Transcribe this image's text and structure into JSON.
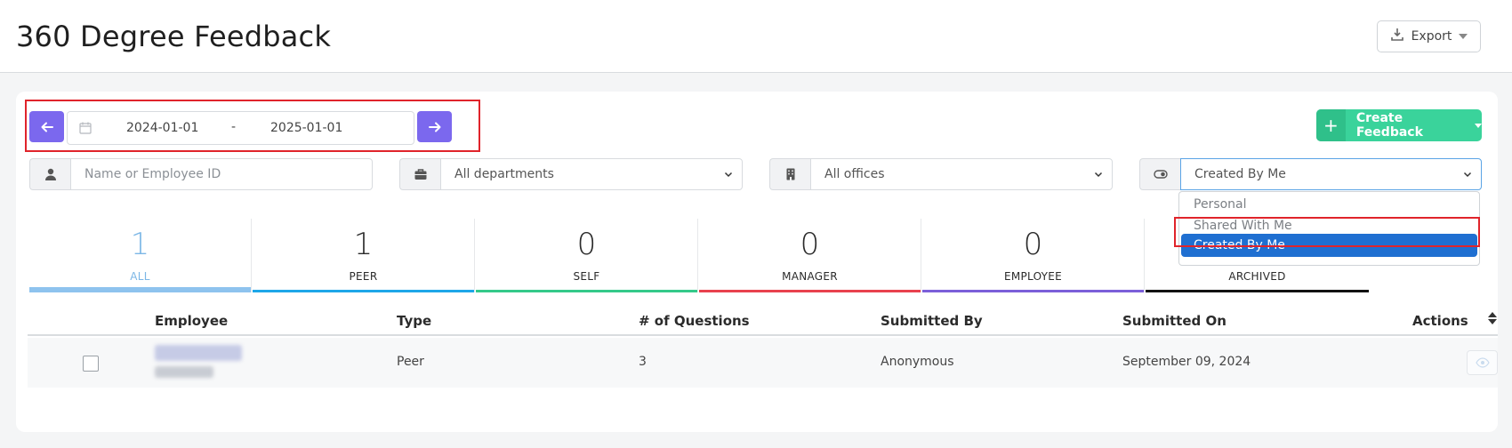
{
  "header": {
    "title": "360 Degree Feedback",
    "export_label": "Export"
  },
  "date_range": {
    "start": "2024-01-01",
    "separator": "-",
    "end": "2025-01-01"
  },
  "create_button": {
    "plus": "+",
    "label": "Create Feedback"
  },
  "filters": {
    "name_placeholder": "Name or Employee ID",
    "department": "All departments",
    "office": "All offices",
    "visibility": "Created By Me"
  },
  "visibility_dropdown": {
    "options": [
      "Personal",
      "Shared With Me",
      "Created By Me"
    ],
    "selected": "Created By Me"
  },
  "stats": [
    {
      "count": "1",
      "label": "ALL",
      "color": "#7cb7e6"
    },
    {
      "count": "1",
      "label": "PEER",
      "color": "#1ea7e8"
    },
    {
      "count": "0",
      "label": "SELF",
      "color": "#34c98a"
    },
    {
      "count": "0",
      "label": "MANAGER",
      "color": "#e8414e"
    },
    {
      "count": "0",
      "label": "EMPLOYEE",
      "color": "#7b5fd9"
    },
    {
      "count": "",
      "label": "ARCHIVED",
      "color": "#111111"
    }
  ],
  "table": {
    "headers": {
      "employee": "Employee",
      "type": "Type",
      "questions": "# of Questions",
      "submitted_by": "Submitted By",
      "submitted_on": "Submitted On",
      "actions": "Actions"
    },
    "rows": [
      {
        "type": "Peer",
        "questions": "3",
        "submitted_by": "Anonymous",
        "submitted_on": "September 09, 2024"
      }
    ]
  }
}
